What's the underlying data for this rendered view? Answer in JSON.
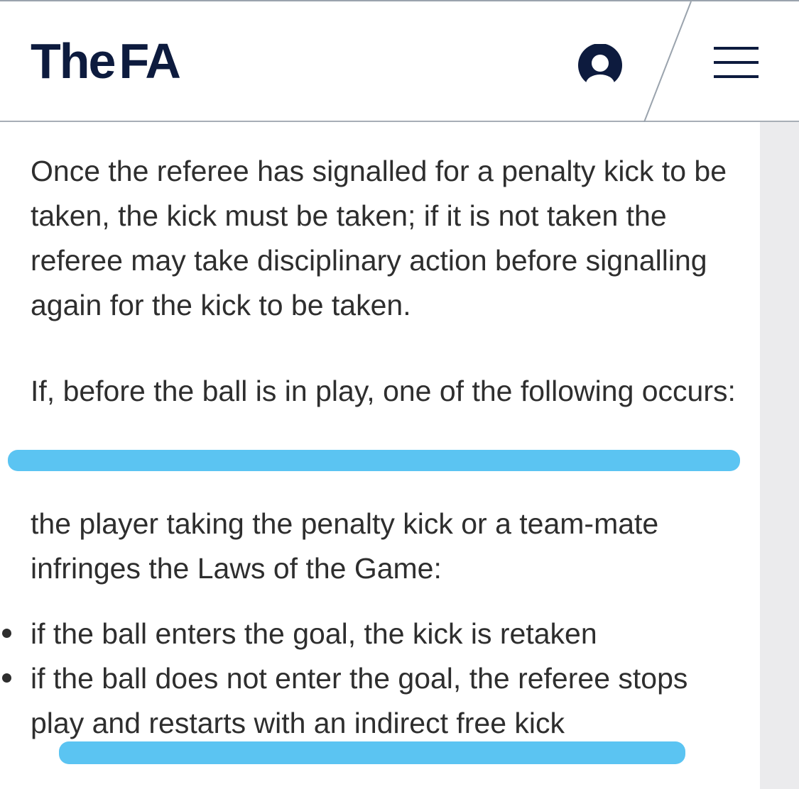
{
  "header": {
    "logo_the": "The",
    "logo_fa": "FA",
    "brand_color": "#0d1b3e"
  },
  "icons": {
    "account": "user-account-icon",
    "menu": "hamburger-menu-icon"
  },
  "content": {
    "paragraph_1": "Once the referee has signalled for a penalty kick to be taken, the kick must be taken; if it is not taken the referee may take disciplinary action before signalling again for the kick to be taken.",
    "paragraph_2": "If, before the ball is in play, one of the following occurs:",
    "paragraph_3": "the player taking the penalty kick or a team-mate infringes the Laws of the Game:",
    "bullets": [
      "if the ball enters the goal, the kick is retaken",
      "if the ball does not enter the goal, the referee stops play and restarts with an indirect free kick"
    ]
  },
  "highlight_color": "#5bc4f2"
}
